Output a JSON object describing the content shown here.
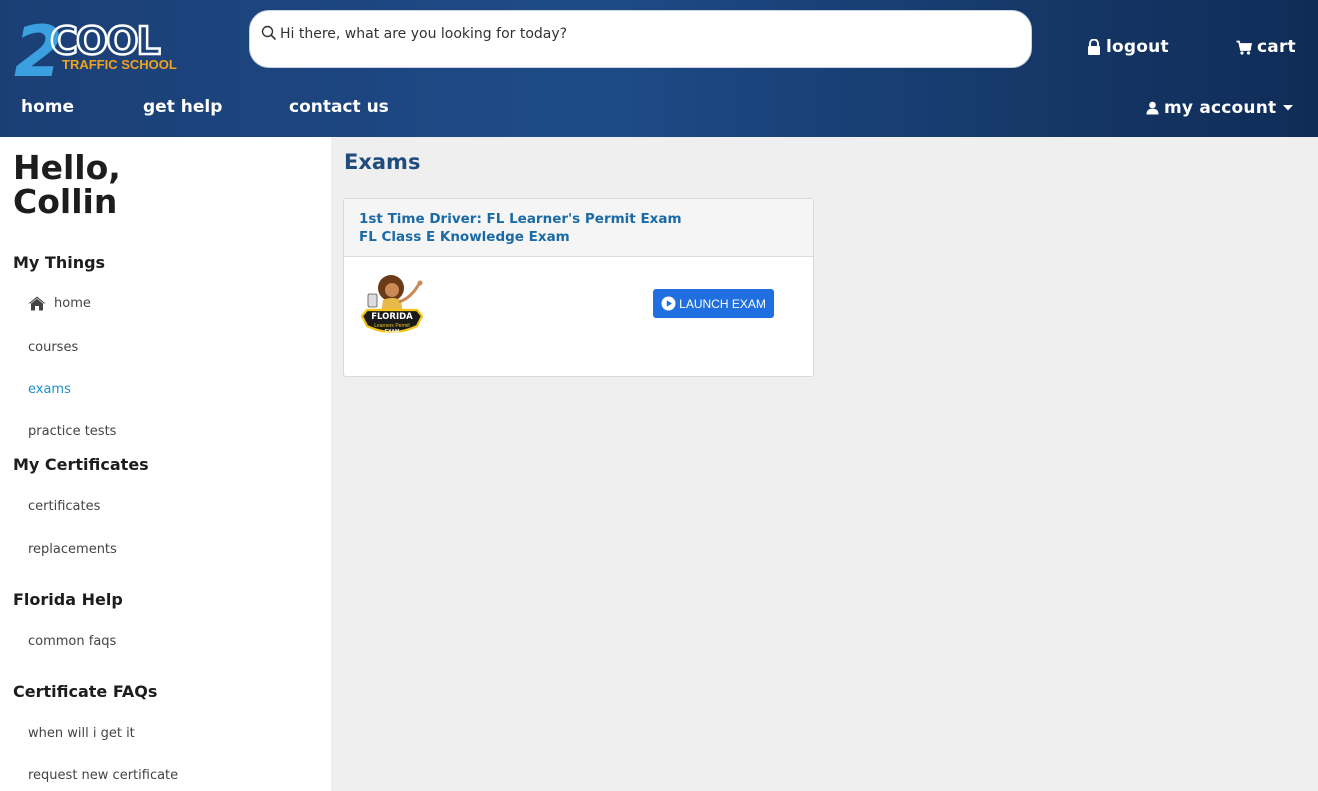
{
  "header": {
    "logo": {
      "number": "2",
      "word": "COOL",
      "tagline": "TRAFFIC SCHOOL"
    },
    "search": {
      "placeholder": "Hi there, what are you looking for today?"
    },
    "logout_label": "logout",
    "cart_label": "cart",
    "nav": [
      {
        "label": "home"
      },
      {
        "label": "get help"
      },
      {
        "label": "contact us"
      }
    ],
    "account_label": "my account"
  },
  "sidebar": {
    "greeting_line1": "Hello,",
    "greeting_line2": "Collin",
    "sections": [
      {
        "title": "My Things",
        "items": [
          {
            "label": "home",
            "icon": "home-icon"
          },
          {
            "label": "courses"
          },
          {
            "label": "exams",
            "active": true
          },
          {
            "label": "practice tests"
          }
        ]
      },
      {
        "title": "My Certificates",
        "items": [
          {
            "label": "certificates"
          },
          {
            "label": "replacements"
          }
        ]
      },
      {
        "title": "Florida Help",
        "items": [
          {
            "label": "common faqs"
          }
        ]
      },
      {
        "title": "Certificate FAQs",
        "items": [
          {
            "label": "when will i get it"
          },
          {
            "label": "request new certificate"
          }
        ]
      }
    ]
  },
  "main": {
    "title": "Exams",
    "exam_card": {
      "title_line1": "1st Time Driver: FL Learner's Permit Exam",
      "title_line2": "FL Class E Knowledge Exam",
      "badge_text_1": "FLORIDA",
      "badge_text_2": "Learners Permit",
      "badge_text_3": "EXAM",
      "launch_label": "LAUNCH EXAM"
    }
  },
  "colors": {
    "header_bg": "#1e4b88",
    "accent_orange": "#f0a21e",
    "logo_blue": "#3aa0e0",
    "link_active": "#1e90c8",
    "title_blue": "#1f4b7d",
    "button_blue": "#1f6fe0"
  }
}
